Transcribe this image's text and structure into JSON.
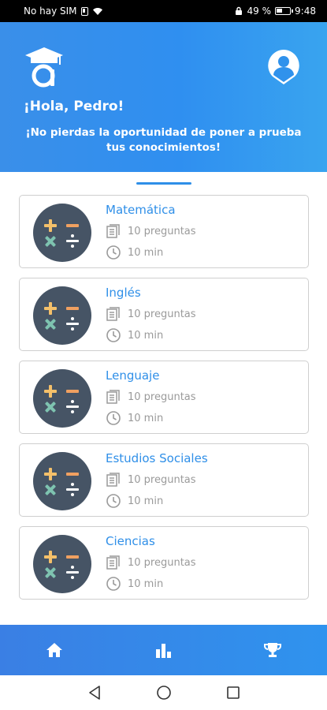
{
  "status_bar": {
    "carrier": "No hay SIM",
    "battery": "49 %",
    "time": "9:48"
  },
  "header": {
    "greeting": "¡Hola, Pedro!",
    "tagline": "¡No pierdas la oportunidad de poner a prueba tus conocimientos!"
  },
  "quizzes": [
    {
      "title": "Matemática",
      "questions": "10 preguntas",
      "time": "10 min"
    },
    {
      "title": "Inglés",
      "questions": "10 preguntas",
      "time": "10 min"
    },
    {
      "title": "Lenguaje",
      "questions": "10 preguntas",
      "time": "10 min"
    },
    {
      "title": "Estudios Sociales",
      "questions": "10 preguntas",
      "time": "10 min"
    },
    {
      "title": "Ciencias",
      "questions": "10 preguntas",
      "time": "10 min"
    }
  ],
  "icons": {
    "logo": "graduation-cap-a-icon",
    "profile": "user-pin-icon",
    "quiz": "math-operators-icon",
    "questions": "document-list-icon",
    "time": "clock-icon",
    "nav": [
      "home-icon",
      "bar-chart-icon",
      "trophy-icon"
    ],
    "system": [
      "back-icon",
      "home-circle-icon",
      "recents-icon"
    ]
  },
  "colors": {
    "accent": "#2f8fe8",
    "icon_circle": "#465465",
    "plus": "#f4c06a",
    "minus": "#f0a060",
    "times": "#7ec3b0",
    "divide": "#ffffff"
  }
}
